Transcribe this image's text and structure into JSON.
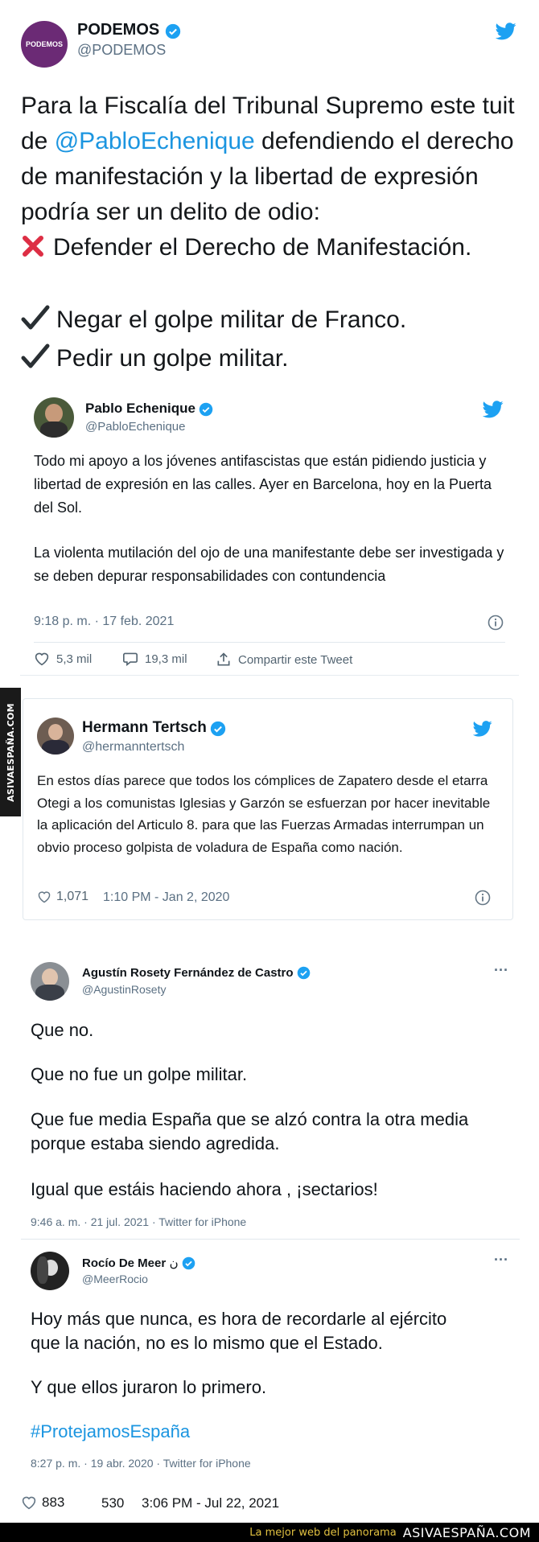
{
  "main_tweet": {
    "avatar_text": "PODEMOS",
    "name": "PODEMOS",
    "handle": "@PODEMOS",
    "text_part1": "Para la Fiscalía del Tribunal Supremo este tuit de ",
    "mention": "@PabloEchenique",
    "text_part2": " defendiendo el derecho de manifestación y la libertad de expresión podría ser un delito de odio:",
    "line_x": "Defender el Derecho de Manifestación.",
    "line_check1": "Negar el golpe militar de Franco.",
    "line_check2": "Pedir un golpe militar.",
    "likes": "883",
    "retweets": "530",
    "timestamp": "3:06 PM - Jul 22, 2021"
  },
  "embed1": {
    "name": "Pablo Echenique",
    "handle": "@PabloEchenique",
    "paragraph1": "Todo mi apoyo a los jóvenes antifascistas que están pidiendo justicia y libertad de expresión en las calles. Ayer en Barcelona, hoy en la Puerta del Sol.",
    "paragraph2": "La violenta mutilación del ojo de una manifestante debe ser investigada y se deben depurar responsabilidades con contundencia",
    "timestamp": "9:18 p. m. · 17 feb. 2021",
    "likes": "5,3 mil",
    "replies": "19,3 mil",
    "share_label": "Compartir este Tweet"
  },
  "embed2": {
    "name": "Hermann Tertsch",
    "handle": "@hermanntertsch",
    "text": "En estos días parece que todos los cómplices de Zapatero desde el etarra Otegi a los comunistas Iglesias y Garzón se esfuerzan por hacer inevitable la aplicación del Articulo 8. para que las Fuerzas Armadas interrumpan un obvio proceso golpista de voladura de España como nación.",
    "likes": "1,071",
    "timestamp": "1:10 PM - Jan 2, 2020"
  },
  "embed3": {
    "name": "Agustín Rosety Fernández de Castro",
    "handle": "@AgustinRosety",
    "p1": "Que no.",
    "p2": "Que no fue un golpe militar.",
    "p3": "Que fue media España que se alzó contra la otra media porque estaba siendo agredida.",
    "p4": "Igual que estáis haciendo ahora , ¡sectarios!",
    "timestamp": "9:46 a. m. · 21 jul. 2021 · Twitter for iPhone",
    "more": "···"
  },
  "embed4": {
    "name": "Rocío De Meer",
    "name_suffix": "ن",
    "handle": "@MeerRocio",
    "p1": "Hoy más que nunca, es hora de recordarle al ejército que la nación, no es lo mismo que el Estado.",
    "p2": "Y que ellos juraron lo primero.",
    "hashtag": "#ProtejamosEspaña",
    "timestamp": "8:27 p. m. · 19 abr. 2020 · Twitter for iPhone",
    "more": "···"
  },
  "watermark": {
    "side_text": "ASIVAESPAÑA.COM",
    "footer_slogan": "La mejor web del panorama",
    "footer_site": "ASIVAESPAÑA.COM"
  },
  "colors": {
    "twitter_blue": "#1da1f2",
    "podemos_purple": "#6b2a75",
    "link_blue": "#1b95e0"
  }
}
